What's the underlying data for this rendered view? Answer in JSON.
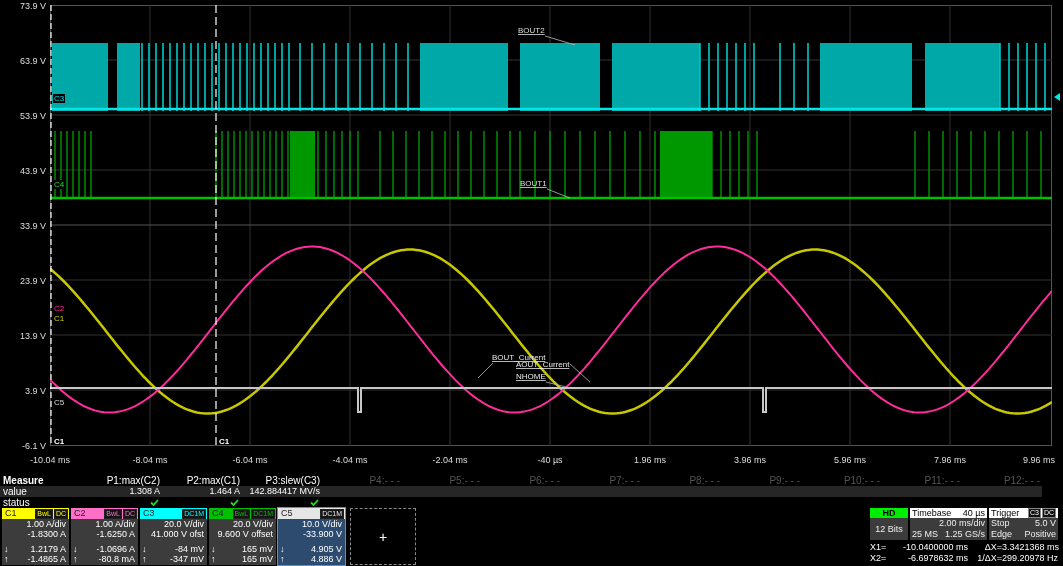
{
  "y_axis": [
    "73.9 V",
    "63.9 V",
    "53.9 V",
    "43.9 V",
    "33.9 V",
    "23.9 V",
    "13.9 V",
    "3.9 V",
    "-6.1 V"
  ],
  "x_axis": [
    "-10.04 ms",
    "-8.04 ms",
    "-6.04 ms",
    "-4.04 ms",
    "-2.04 ms",
    "-40 µs",
    "1.96 ms",
    "3.96 ms",
    "5.96 ms",
    "7.96 ms",
    "9.96 ms"
  ],
  "trace_labels": [
    {
      "text": "BOUT2",
      "kind": "pwm"
    },
    {
      "text": "BOUT1",
      "kind": "pwm"
    },
    {
      "text": "BOUT_Current",
      "kind": "analog"
    },
    {
      "text": "AOUT_Current",
      "kind": "analog"
    },
    {
      "text": "NHOME",
      "kind": "analog"
    }
  ],
  "channel_markers": [
    "C3",
    "C4",
    "C2",
    "C1",
    "C5"
  ],
  "cursor_labels": [
    "C1",
    "C1"
  ],
  "measure": {
    "title": "Measure",
    "rows": [
      "value",
      "status"
    ],
    "params": [
      {
        "label": "P1:max(C2)",
        "value": "1.308 A",
        "ok": true,
        "disabled": false
      },
      {
        "label": "P2:max(C1)",
        "value": "1.464 A",
        "ok": true,
        "disabled": false
      },
      {
        "label": "P3:slew(C3)",
        "value": "142.884417 MV/s",
        "ok": true,
        "disabled": false
      },
      {
        "label": "P4:- - -",
        "ok": false,
        "disabled": true
      },
      {
        "label": "P5:- - -",
        "ok": false,
        "disabled": true
      },
      {
        "label": "P6:- - -",
        "ok": false,
        "disabled": true
      },
      {
        "label": "P7:- - -",
        "ok": false,
        "disabled": true
      },
      {
        "label": "P8:- - -",
        "ok": false,
        "disabled": true
      },
      {
        "label": "P9:- - -",
        "ok": false,
        "disabled": true
      },
      {
        "label": "P10:- - -",
        "ok": false,
        "disabled": true
      },
      {
        "label": "P11:- - -",
        "ok": false,
        "disabled": true
      },
      {
        "label": "P12:- - -",
        "ok": false,
        "disabled": true
      }
    ]
  },
  "channels": [
    {
      "name": "C1",
      "color": "#ffff00",
      "tags": [
        "BwL",
        "DC"
      ],
      "scale": "1.00 A/div",
      "offset": "-1.8300 A",
      "readings": [
        {
          "mark": "↓",
          "value": "1.2179 A"
        },
        {
          "mark": "↑",
          "value": "-1.4865 A"
        }
      ],
      "selected": false
    },
    {
      "name": "C2",
      "color": "#ff6ec7",
      "tags": [
        "BwL",
        "DC"
      ],
      "scale": "1.00 A/div",
      "offset": "-1.6250 A",
      "readings": [
        {
          "mark": "↓",
          "value": "-1.0696 A"
        },
        {
          "mark": "↑",
          "value": "-80.8 mA"
        }
      ],
      "selected": false
    },
    {
      "name": "C3",
      "color": "#00ffff",
      "tags": [
        "DC1M"
      ],
      "scale": "20.0 V/div",
      "offset": "41.000 V ofst",
      "readings": [
        {
          "mark": "↓",
          "value": "-84 mV"
        },
        {
          "mark": "↑",
          "value": "-347 mV"
        }
      ],
      "selected": false
    },
    {
      "name": "C4",
      "color": "#00c000",
      "tags": [
        "BwL",
        "DC1M"
      ],
      "scale": "20.0 V/div",
      "offset": "9.600 V offset",
      "readings": [
        {
          "mark": "↓",
          "value": "165 mV"
        },
        {
          "mark": "↑",
          "value": "165 mV"
        }
      ],
      "selected": false
    },
    {
      "name": "C5",
      "color": "#e6e6e6",
      "tags": [
        "DC1M"
      ],
      "scale": "10.0 V/div",
      "offset": "-33.900 V",
      "readings": [
        {
          "mark": "↓",
          "value": "4.905 V"
        },
        {
          "mark": "↑",
          "value": "4.886 V"
        }
      ],
      "selected": true
    }
  ],
  "add_button": "+",
  "acquisition": {
    "badge": "HD",
    "bits": "12 Bits"
  },
  "timebase": {
    "title": "Timebase",
    "delay": "40 µs",
    "rate": "2.00 ms/div",
    "points": "25 MS",
    "sample_rate": "1.25 GS/s"
  },
  "trigger": {
    "title": "Trigger",
    "source": "C3",
    "coupling": "DC",
    "mode": "Stop",
    "level": "5.0 V",
    "type": "Edge",
    "slope": "Positive"
  },
  "cursors": [
    {
      "label": "X1=",
      "value": "-10.0400000 ms",
      "delta_label": "ΔX=",
      "delta": "3.3421368 ms"
    },
    {
      "label": "X2=",
      "value": "-6.6978632 ms",
      "delta_label": "1/ΔX=",
      "delta": "299.20978 Hz"
    }
  ]
}
